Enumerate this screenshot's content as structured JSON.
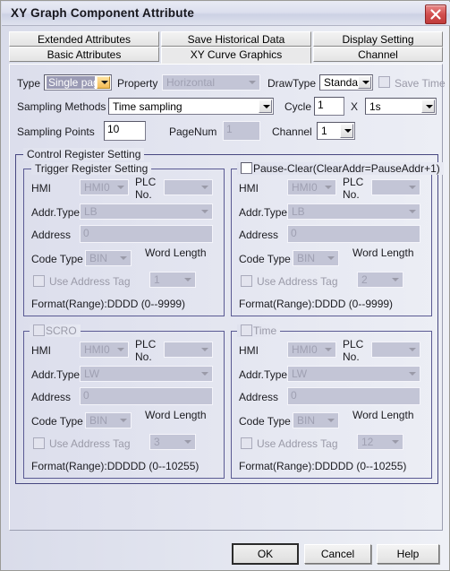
{
  "window": {
    "title": "XY Graph Component Attribute",
    "close_icon": "close-icon"
  },
  "tabs": {
    "row1": [
      {
        "label": "Extended Attributes",
        "selected": false
      },
      {
        "label": "Save Historical Data",
        "selected": false
      },
      {
        "label": "Display Setting",
        "selected": false
      }
    ],
    "row2": [
      {
        "label": "Basic Attributes",
        "selected": false
      },
      {
        "label": "XY Curve Graphics",
        "selected": true
      },
      {
        "label": "Channel",
        "selected": false
      }
    ]
  },
  "form": {
    "type_label": "Type",
    "type_value": "Single pag",
    "property_label": "Property",
    "property_value": "Horizontal",
    "drawtype_label": "DrawType",
    "drawtype_value": "Standar",
    "savetime_label": "Save Time",
    "savetime_checked": false,
    "sampling_methods_label": "Sampling Methods",
    "sampling_methods_value": "Time sampling",
    "cycle_label": "Cycle",
    "cycle_value": "1",
    "times_symbol": "X",
    "cycle_unit_value": "1s",
    "sampling_points_label": "Sampling Points",
    "sampling_points_value": "10",
    "pagenum_label": "PageNum",
    "pagenum_value": "1",
    "channel_label": "Channel",
    "channel_value": "1"
  },
  "control_register": {
    "caption": "Control Register Setting",
    "groups": [
      {
        "caption": "Trigger Register Setting",
        "has_checkbox": false,
        "checked": false,
        "hmi_label": "HMI",
        "hmi_value": "HMI0",
        "plc_label": "PLC No.",
        "plc_value": "",
        "addrtype_label": "Addr.Type",
        "addrtype_value": "LB",
        "address_label": "Address",
        "address_value": "0",
        "codetype_label": "Code Type",
        "codetype_value": "BIN",
        "wordlength_label": "Word Length",
        "wordlength_value": "1",
        "useaddrtag_label": "Use Address Tag",
        "useaddrtag_checked": false,
        "format_text": "Format(Range):DDDD (0--9999)"
      },
      {
        "caption": "Pause-Clear(ClearAddr=PauseAddr+1)",
        "has_checkbox": true,
        "checked": false,
        "hmi_label": "HMI",
        "hmi_value": "HMI0",
        "plc_label": "PLC No.",
        "plc_value": "",
        "addrtype_label": "Addr.Type",
        "addrtype_value": "LB",
        "address_label": "Address",
        "address_value": "0",
        "codetype_label": "Code Type",
        "codetype_value": "BIN",
        "wordlength_label": "Word Length",
        "wordlength_value": "2",
        "useaddrtag_label": "Use Address Tag",
        "useaddrtag_checked": false,
        "format_text": "Format(Range):DDDD (0--9999)"
      },
      {
        "caption": "SCRO",
        "has_checkbox": true,
        "checked": false,
        "hmi_label": "HMI",
        "hmi_value": "HMI0",
        "plc_label": "PLC No.",
        "plc_value": "",
        "addrtype_label": "Addr.Type",
        "addrtype_value": "LW",
        "address_label": "Address",
        "address_value": "0",
        "codetype_label": "Code Type",
        "codetype_value": "BIN",
        "wordlength_label": "Word Length",
        "wordlength_value": "3",
        "useaddrtag_label": "Use Address Tag",
        "useaddrtag_checked": false,
        "format_text": "Format(Range):DDDDD (0--10255)"
      },
      {
        "caption": "Time",
        "has_checkbox": true,
        "checked": false,
        "hmi_label": "HMI",
        "hmi_value": "HMI0",
        "plc_label": "PLC No.",
        "plc_value": "",
        "addrtype_label": "Addr.Type",
        "addrtype_value": "LW",
        "address_label": "Address",
        "address_value": "0",
        "codetype_label": "Code Type",
        "codetype_value": "BIN",
        "wordlength_label": "Word Length",
        "wordlength_value": "12",
        "useaddrtag_label": "Use Address Tag",
        "useaddrtag_checked": false,
        "format_text": "Format(Range):DDDDD (0--10255)"
      }
    ]
  },
  "footer": {
    "ok_label": "OK",
    "cancel_label": "Cancel",
    "help_label": "Help"
  },
  "colors": {
    "group_border": "#474780",
    "close_red": "#d24f4f",
    "focus_highlight": "#9a9ab4",
    "dropdown_accent": "#f5bc54"
  }
}
